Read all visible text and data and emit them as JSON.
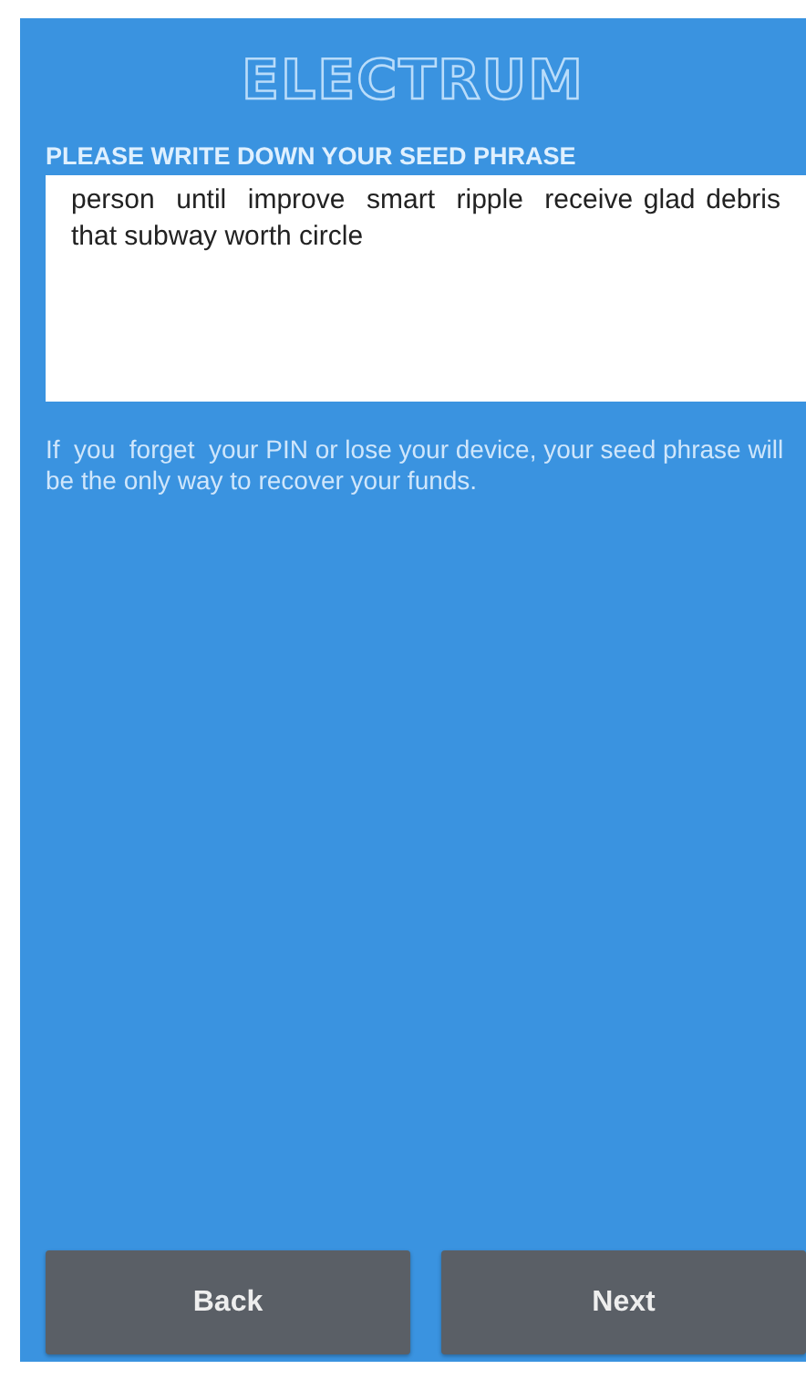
{
  "logo": "ELECTRUM",
  "heading": "PLEASE WRITE DOWN YOUR SEED PHRASE",
  "seed_phrase": "person  until  improve  smart  ripple  receive glad debris that subway worth circle",
  "warning": "If  you  forget  your PIN or lose your device, your seed phrase will be the only way to recover your funds.",
  "buttons": [
    {
      "label": "Back"
    },
    {
      "label": "Next"
    }
  ]
}
